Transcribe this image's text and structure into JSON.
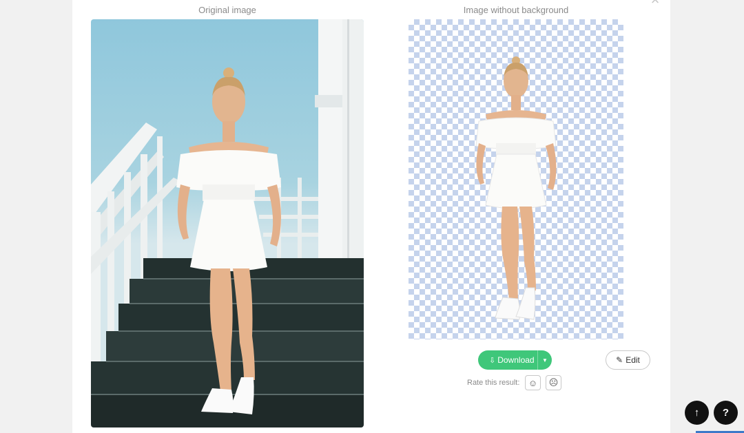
{
  "original_label": "Original image",
  "result_label": "Image without background",
  "close_glyph": "×",
  "download": {
    "label": "Download",
    "icon": "download-icon"
  },
  "edit": {
    "label": "Edit",
    "icon": "pencil-icon"
  },
  "rating": {
    "label": "Rate this result:",
    "good_icon": "smile-icon",
    "bad_icon": "frown-icon"
  },
  "fab": {
    "up_icon": "arrow-up-icon",
    "help_label": "?"
  },
  "colors": {
    "accent_green": "#3fc77a",
    "checker_blue": "#c5d3ec",
    "fab_dark": "#111111"
  }
}
